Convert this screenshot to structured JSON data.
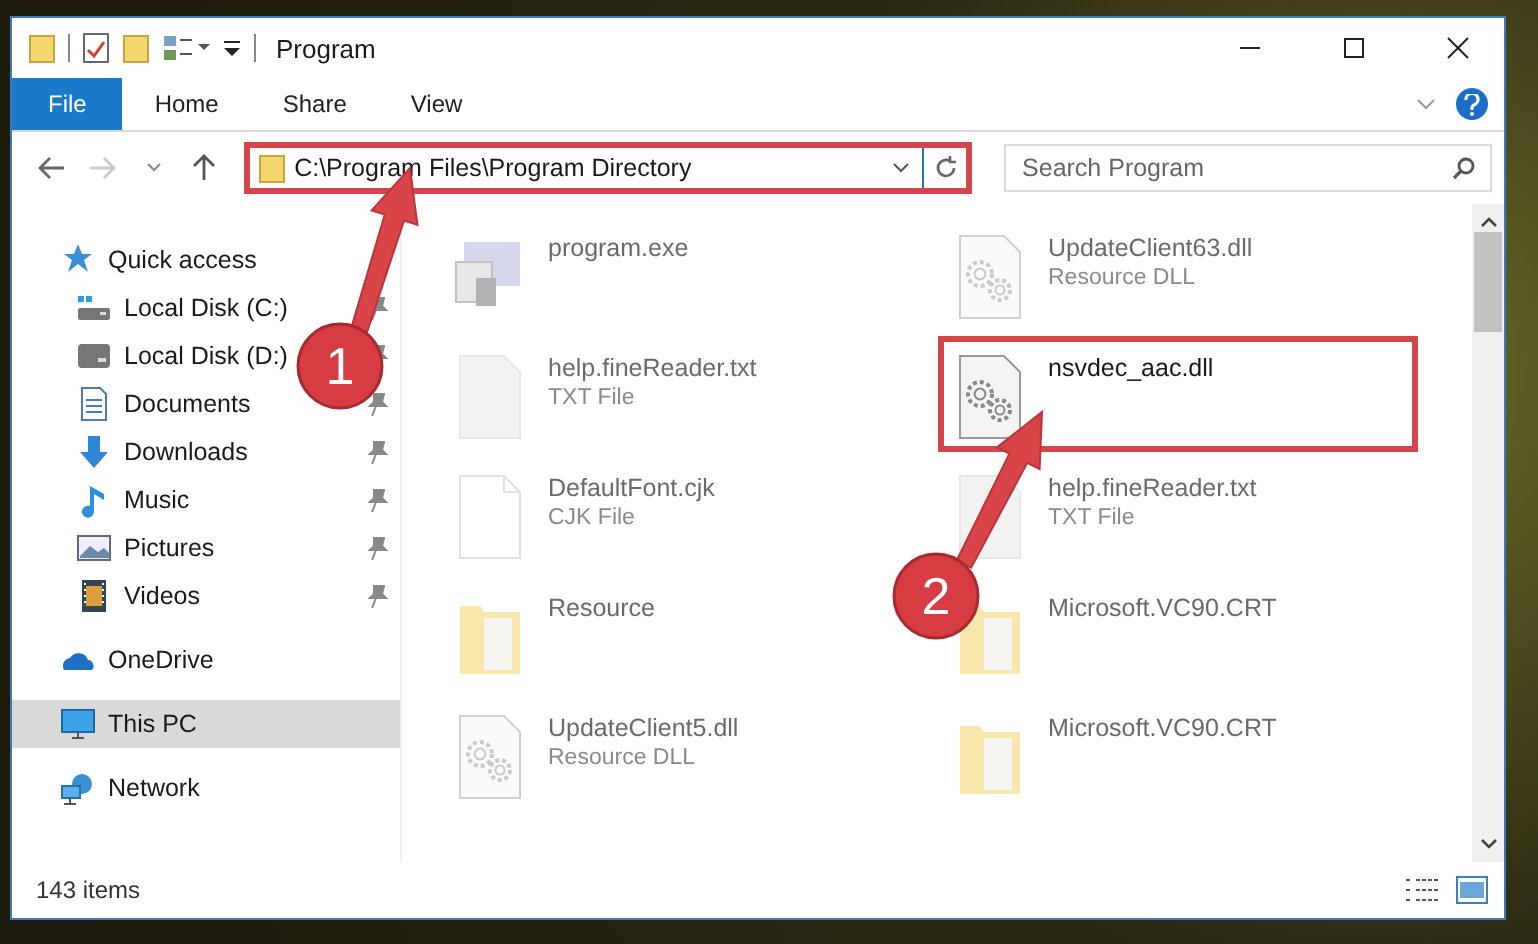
{
  "window": {
    "title": "Program"
  },
  "ribbon_tabs": [
    {
      "label": "File",
      "selected": true
    },
    {
      "label": "Home",
      "selected": false
    },
    {
      "label": "Share",
      "selected": false
    },
    {
      "label": "View",
      "selected": false
    }
  ],
  "address": {
    "path": "C:\\Program Files\\Program Directory",
    "highlighted": true
  },
  "search": {
    "placeholder": "Search Program"
  },
  "nav": [
    {
      "label": "Quick access",
      "selected": false,
      "children": [
        {
          "label": "Local Disk (C:)",
          "pinned": true,
          "selected": false
        },
        {
          "label": "Local Disk (D:)",
          "pinned": true,
          "selected": false
        },
        {
          "label": "Documents",
          "pinned": true,
          "selected": false
        },
        {
          "label": "Downloads",
          "pinned": true,
          "selected": false
        },
        {
          "label": "Music",
          "pinned": true,
          "selected": false
        },
        {
          "label": "Pictures",
          "pinned": true,
          "selected": false
        },
        {
          "label": "Videos",
          "pinned": true,
          "selected": false
        }
      ]
    },
    {
      "label": "OneDrive",
      "selected": false
    },
    {
      "label": "This PC",
      "selected": true
    },
    {
      "label": "Network",
      "selected": false
    }
  ],
  "files": [
    {
      "name": "program.exe",
      "kind": "exe",
      "blurred": true,
      "highlighted": false
    },
    {
      "name": "UpdateClient63.dll",
      "type": "Resource DLL",
      "kind": "dll",
      "blurred": true,
      "highlighted": false
    },
    {
      "name": "help.fineReader.txt",
      "type": "TXT File",
      "kind": "text",
      "blurred": true,
      "highlighted": false
    },
    {
      "name": "nsvdec_aac.dll",
      "kind": "dll",
      "blurred": false,
      "highlighted": true
    },
    {
      "name": "DefaultFont.cjk",
      "type": "CJK File",
      "kind": "blank",
      "blurred": true,
      "highlighted": false
    },
    {
      "name": "help.fineReader.txt",
      "type": "TXT File",
      "kind": "text",
      "blurred": true,
      "highlighted": false
    },
    {
      "name": "Resource",
      "kind": "folder",
      "blurred": true,
      "highlighted": false
    },
    {
      "name": "Microsoft.VC90.CRT",
      "kind": "folder",
      "blurred": true,
      "highlighted": false
    },
    {
      "name": "UpdateClient5.dll",
      "type": "Resource DLL",
      "kind": "dll",
      "blurred": true,
      "highlighted": false
    },
    {
      "name": "Microsoft.VC90.CRT",
      "kind": "folder",
      "blurred": true,
      "highlighted": false
    }
  ],
  "annotations": [
    {
      "number": "1"
    },
    {
      "number": "2"
    }
  ],
  "status_bar": {
    "item_count": "143 items"
  }
}
